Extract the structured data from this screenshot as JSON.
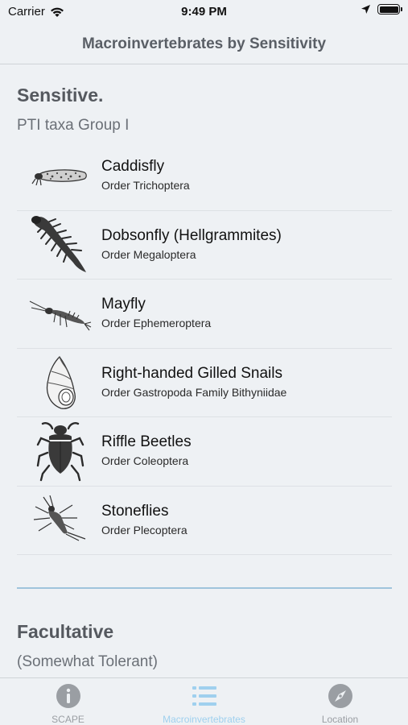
{
  "status_bar": {
    "carrier": "Carrier",
    "time": "9:49 PM"
  },
  "nav": {
    "title": "Macroinvertebrates by Sensitivity"
  },
  "sections": [
    {
      "title": "Sensitive.",
      "subtitle": "PTI taxa Group I",
      "items": [
        {
          "name": "Caddisfly",
          "order": "Order Trichoptera",
          "icon": "caddisfly-icon"
        },
        {
          "name": "Dobsonfly (Hellgrammites)",
          "order": "Order Megaloptera",
          "icon": "dobsonfly-icon"
        },
        {
          "name": "Mayfly",
          "order": "Order Ephemeroptera",
          "icon": "mayfly-icon"
        },
        {
          "name": "Right-handed Gilled Snails",
          "order": "Order Gastropoda Family Bithyniidae",
          "icon": "snail-icon"
        },
        {
          "name": "Riffle Beetles",
          "order": "Order Coleoptera",
          "icon": "beetle-icon"
        },
        {
          "name": "Stoneflies",
          "order": "Order Plecoptera",
          "icon": "stonefly-icon"
        }
      ]
    },
    {
      "title": "Facultative",
      "subtitle": "(Somewhat Tolerant)"
    }
  ],
  "tabs": [
    {
      "label": "SCAPE",
      "icon": "info-icon",
      "active": false
    },
    {
      "label": "Macroinvertebrates",
      "icon": "list-icon",
      "active": true
    },
    {
      "label": "Location",
      "icon": "compass-icon",
      "active": false
    }
  ],
  "colors": {
    "accent": "#9fd0ee",
    "divider": "#9fc4dc",
    "background": "#eef1f4"
  }
}
